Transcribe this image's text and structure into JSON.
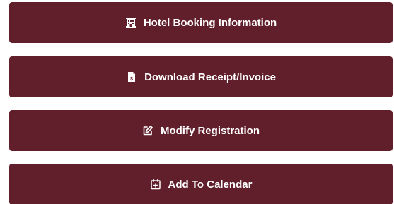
{
  "buttons": [
    {
      "label": "Hotel Booking Information",
      "icon": "hotel-icon"
    },
    {
      "label": "Download Receipt/Invoice",
      "icon": "invoice-file-icon"
    },
    {
      "label": "Modify Registration",
      "icon": "edit-icon"
    },
    {
      "label": "Add To Calendar",
      "icon": "calendar-plus-icon"
    }
  ],
  "colors": {
    "button_bg": "#611f2b",
    "button_text": "#ffffff"
  }
}
